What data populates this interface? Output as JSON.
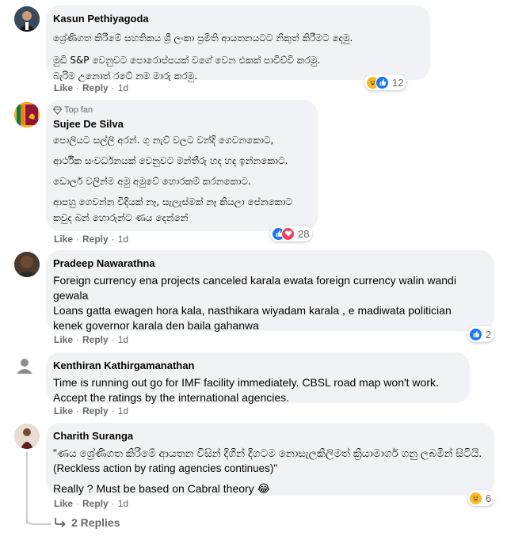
{
  "comments": [
    {
      "author": "Kasun Pethiyagoda",
      "lines": [
        "ශ්‍රේණිගත කිරීමේ සහතිකය ශ්‍රී ලංකා ප්‍රමිති ආයතනයටට නිකුත් කිරීමට දෙමු.",
        "මුඩි S&P වෙනුවට පොරොප්පයක් වගේ වෙන එකක් පාවිච්චි කරමු.\nබැරිම උනොත් රටේ නම මාරු කරමු."
      ],
      "like": "Like",
      "reply": "Reply",
      "time": "1d",
      "reaction_count": "12"
    },
    {
      "badge": "Top fan",
      "author": "Sujee De Silva",
      "lines": [
        "පොලියට සල්ලි අරන්. ගු නැව් වලට වන්දි ගෙවනකොට,",
        "ආර්ථික සංවර්ධනයක් වෙනුවට මන්තීරු හද හද ඉන්නකොට.",
        "ඩොලර් වලින්ම අමු අමුවේ හොරකම් කරනකොට.",
        "ආපහු ගෙවන්න විදියක් නෑ, සැලැස්මක් නෑ කියලා පේනකොට\nකවුද බන් හොරුන්ට ණය දෙන්නේ"
      ],
      "like": "Like",
      "reply": "Reply",
      "time": "1d",
      "reaction_count": "28"
    },
    {
      "author": "Pradeep Nawarathna",
      "lines": [
        "Foreign currency ena projects canceled karala ewata foreign currency walin wandi\ngewala\nLoans gatta ewagen hora kala, nasthikara wiyadam karala , e madiwata politician\nkenek governor karala den baila gahanwa"
      ],
      "like": "Like",
      "reply": "Reply",
      "time": "1d",
      "reaction_count": "2"
    },
    {
      "author": "Kenthiran Kathirgamanathan",
      "lines": [
        "Time is running out go for IMF facility immediately. CBSL road map won't work.\nAccept the ratings by the international agencies."
      ],
      "like": "Like",
      "reply": "Reply",
      "time": "1d"
    },
    {
      "author": "Charith Suranga",
      "lines": [
        "\"ණය ශ්‍රේණිගත කිරීමේ ආයතන විසින් දිගින් දිගටම නොසැලකිලිමත් ක්‍රියාමාර්ග ගනු ලබමින් සිටියි.\n(Reckless action by rating agencies continues)\"",
        "Really ? Must be based on Cabral theory 😂"
      ],
      "like": "Like",
      "reply": "Reply",
      "time": "1d",
      "reaction_count": "6"
    }
  ],
  "replies_label": "2 Replies",
  "icons": {
    "like": "like-reaction-icon",
    "haha": "haha-reaction-icon",
    "love": "love-reaction-icon",
    "top_fan": "diamond-icon",
    "reply_arrow": "reply-arrow-icon"
  },
  "colors": {
    "bubble": "#f0f2f5",
    "meta": "#65676b",
    "like_blue": "#1877f2",
    "haha_yellow": "#f7b928",
    "love_red": "#f33e58"
  }
}
